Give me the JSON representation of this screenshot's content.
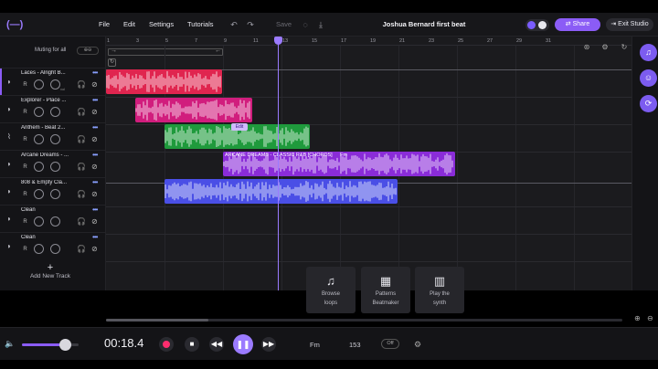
{
  "header": {
    "menu": [
      "File",
      "Edit",
      "Settings",
      "Tutorials"
    ],
    "save_label": "Save",
    "project_title": "Joshua Bernard first beat",
    "share_label": "Share",
    "exit_label": "Exit Studio"
  },
  "tracks_panel": {
    "mute_all_label": "Muting for all",
    "add_track_label": "Add New Track",
    "tracks": [
      {
        "name": "Laces - Alright B...",
        "r": "R"
      },
      {
        "name": "Explorer - Place ...",
        "r": "R"
      },
      {
        "name": "Anthem - Beat 2...",
        "r": "R"
      },
      {
        "name": "Arcane Dreams - ...",
        "r": "R"
      },
      {
        "name": "808 & Empty Cla...",
        "r": "R"
      },
      {
        "name": "Clean",
        "r": "R"
      },
      {
        "name": "Clean",
        "r": "R"
      }
    ]
  },
  "ruler": [
    "1",
    "3",
    "5",
    "7",
    "9",
    "11",
    "13",
    "15",
    "17",
    "19",
    "21",
    "23",
    "25",
    "27",
    "29",
    "31"
  ],
  "clips": {
    "arcane_label": "ARCANE DREAMS - CLASSIC R&B [CHORDS]",
    "arcane_key": "Fm",
    "edit_label": "Edit"
  },
  "tiles": [
    {
      "label1": "Browse",
      "label2": "loops",
      "icon": "music-note-icon"
    },
    {
      "label1": "Patterns",
      "label2": "Beatmaker",
      "icon": "grid-pads-icon"
    },
    {
      "label1": "Play the",
      "label2": "synth",
      "icon": "piano-keys-icon"
    }
  ],
  "transport": {
    "time": "00:18.4",
    "key": "Fm",
    "bpm": "153",
    "metronome": "Off",
    "volume_level": 0.75
  },
  "colors": {
    "accent": "#8b5cf6",
    "clip_red": "#e0254f",
    "clip_pink": "#d11d7d",
    "clip_green": "#1f9a3c",
    "clip_purple": "#8a2cd8",
    "clip_blue": "#4a4fe6"
  }
}
